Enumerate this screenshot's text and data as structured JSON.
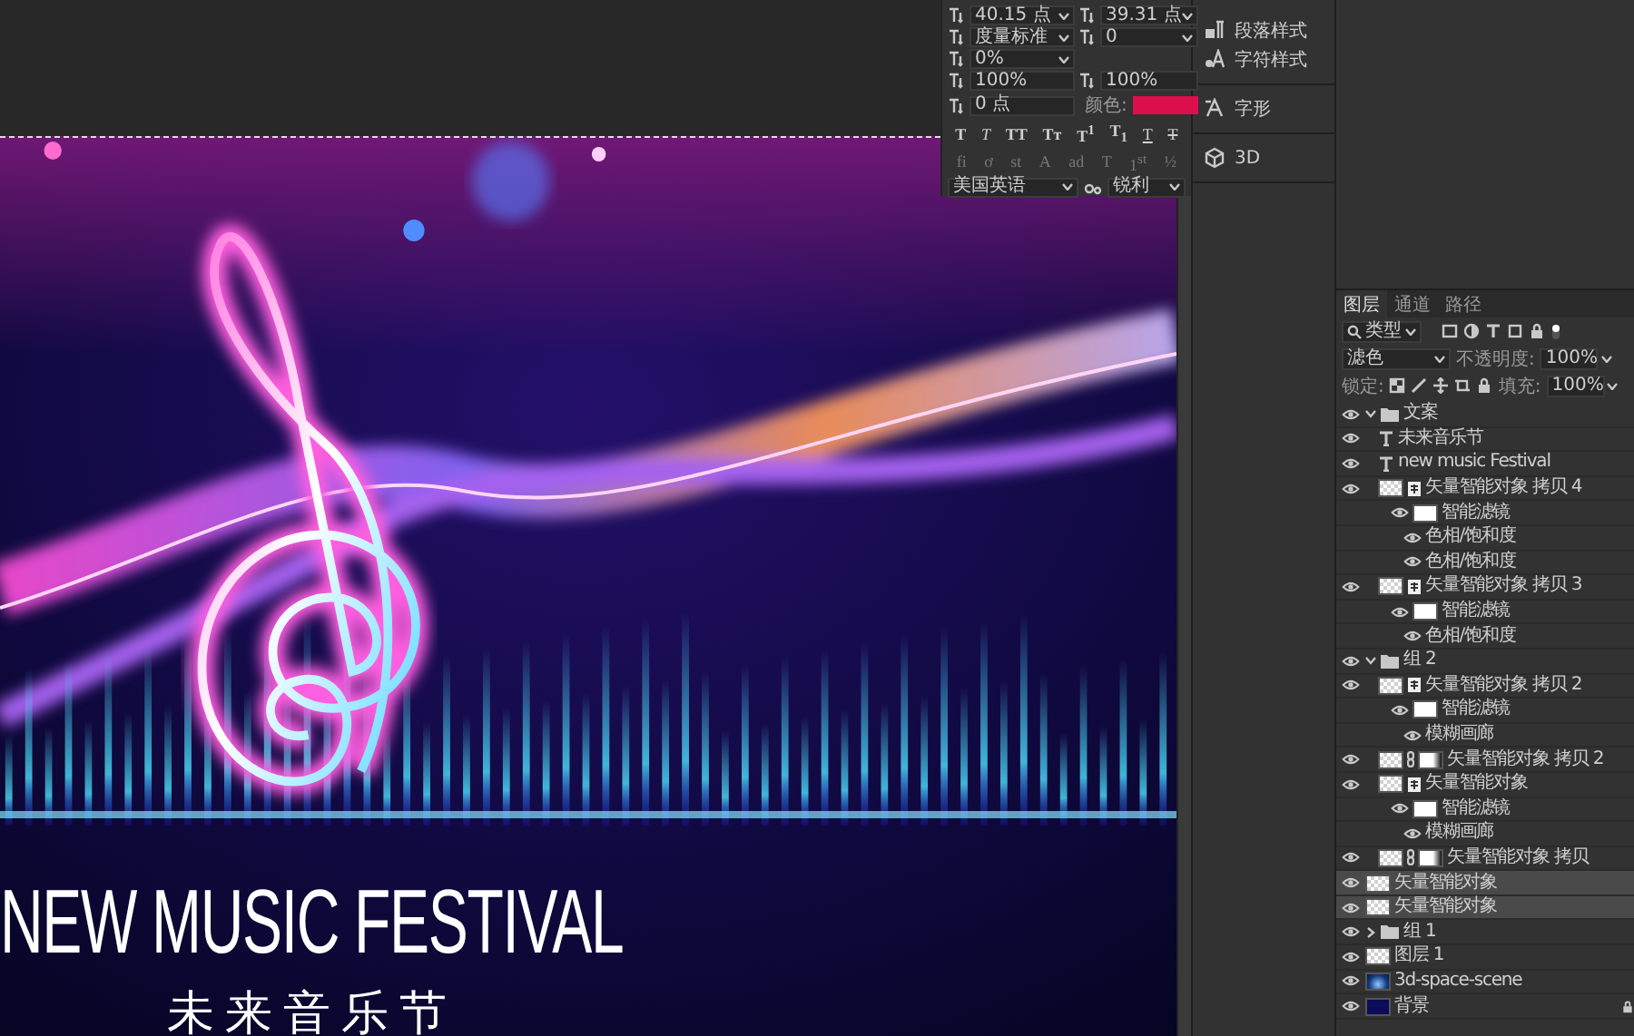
{
  "canvas": {
    "title": "NEW MUSIC FESTIVAL",
    "subtitle": "未来音乐节"
  },
  "character_panel": {
    "font_size": "40.15 点",
    "leading": "39.31 点",
    "kerning": "度量标准",
    "tracking": "0",
    "tsume": "0%",
    "vertical_scale": "100%",
    "horizontal_scale": "100%",
    "baseline_shift": "0 点",
    "color_label": "颜色:",
    "color": "#da0f4b",
    "style_buttons": [
      {
        "label": "T",
        "kind": "bold"
      },
      {
        "label": "T",
        "kind": "italic"
      },
      {
        "label": "TT",
        "kind": "caps"
      },
      {
        "label": "Tᴛ",
        "kind": "smallcaps"
      },
      {
        "label": "T$^{1}$",
        "kind": "super"
      },
      {
        "label": "T$_{1}$",
        "kind": "sub"
      },
      {
        "label": "T",
        "kind": "underline"
      },
      {
        "label": "T",
        "kind": "strike"
      }
    ],
    "opentype_buttons": [
      {
        "label": "fi",
        "disabled": true
      },
      {
        "label": "ơ",
        "disabled": true
      },
      {
        "label": "st",
        "disabled": true
      },
      {
        "label": "A",
        "disabled": true
      },
      {
        "label": "ad",
        "disabled": true
      },
      {
        "label": "T",
        "disabled": true
      },
      {
        "label": "1$^{st}$",
        "disabled": true
      },
      {
        "label": "½",
        "disabled": true
      }
    ],
    "language": "美国英语",
    "antialias": "锐利"
  },
  "side_panel": {
    "sections": [
      {
        "items": [
          {
            "label": "段落样式",
            "kind": "paragraph-styles"
          },
          {
            "label": "字符样式",
            "kind": "character-styles"
          }
        ]
      },
      {
        "items": [
          {
            "label": "字形",
            "kind": "glyphs"
          }
        ]
      },
      {
        "items": [
          {
            "label": "3D",
            "kind": "model"
          }
        ]
      }
    ]
  },
  "layers_panel": {
    "tabs": [
      {
        "label": "图层",
        "selected": true
      },
      {
        "label": "通道",
        "selected": false
      },
      {
        "label": "路径",
        "selected": false
      }
    ],
    "filter_kind": "类型",
    "blend_mode": "滤色",
    "opacity_label": "不透明度:",
    "opacity": "100%",
    "lock_label": "锁定:",
    "fill_label": "填充:",
    "fill": "100%",
    "layers": [
      {
        "name": "文案",
        "kind": "group",
        "visible": true,
        "selected": false,
        "expanded": true,
        "children": [
          {
            "name": "未来音乐节",
            "kind": "text",
            "visible": true,
            "selected": false
          },
          {
            "name": "new music Festival",
            "kind": "text",
            "visible": true,
            "selected": false
          },
          {
            "name": "矢量智能对象 拷贝 4",
            "kind": "smart",
            "visible": true,
            "selected": false,
            "children": [
              {
                "name": "智能滤镜",
                "kind": "filter",
                "visible": true,
                "selected": false,
                "children": [
                  {
                    "name": "色相/饱和度",
                    "kind": "effect",
                    "visible": true,
                    "selected": false
                  },
                  {
                    "name": "色相/饱和度",
                    "kind": "effect",
                    "visible": true,
                    "selected": false
                  }
                ]
              }
            ]
          },
          {
            "name": "矢量智能对象 拷贝 3",
            "kind": "smart",
            "visible": true,
            "selected": false,
            "children": [
              {
                "name": "智能滤镜",
                "kind": "filter",
                "visible": true,
                "selected": false,
                "children": [
                  {
                    "name": "色相/饱和度",
                    "kind": "effect",
                    "visible": true,
                    "selected": false
                  }
                ]
              }
            ]
          }
        ]
      },
      {
        "name": "组 2",
        "kind": "group",
        "visible": true,
        "selected": false,
        "expanded": true,
        "children": [
          {
            "name": "矢量智能对象 拷贝 2",
            "kind": "smart",
            "visible": true,
            "selected": false,
            "children": [
              {
                "name": "智能滤镜",
                "kind": "filter",
                "visible": true,
                "selected": false,
                "children": [
                  {
                    "name": "模糊画廊",
                    "kind": "effect",
                    "visible": true,
                    "selected": false
                  }
                ]
              }
            ]
          },
          {
            "name": "矢量智能对象 拷贝 2",
            "kind": "masked",
            "visible": true,
            "selected": false
          },
          {
            "name": "矢量智能对象",
            "kind": "smart",
            "visible": true,
            "selected": false,
            "children": [
              {
                "name": "智能滤镜",
                "kind": "filter",
                "visible": true,
                "selected": false,
                "children": [
                  {
                    "name": "模糊画廊",
                    "kind": "effect",
                    "visible": true,
                    "selected": false
                  }
                ]
              }
            ]
          },
          {
            "name": "矢量智能对象 拷贝",
            "kind": "masked",
            "visible": true,
            "selected": false
          }
        ]
      },
      {
        "name": "矢量智能对象",
        "kind": "pixel",
        "visible": true,
        "selected": true
      },
      {
        "name": "矢量智能对象",
        "kind": "pixel",
        "visible": true,
        "selected": true
      },
      {
        "name": "组 1",
        "kind": "group",
        "visible": true,
        "selected": false,
        "expanded": false
      },
      {
        "name": "图层 1",
        "kind": "pixel",
        "visible": true,
        "selected": false
      },
      {
        "name": "3d-space-scene",
        "kind": "image",
        "visible": true,
        "selected": false
      },
      {
        "name": "背景",
        "kind": "background",
        "visible": true,
        "selected": false
      }
    ]
  }
}
